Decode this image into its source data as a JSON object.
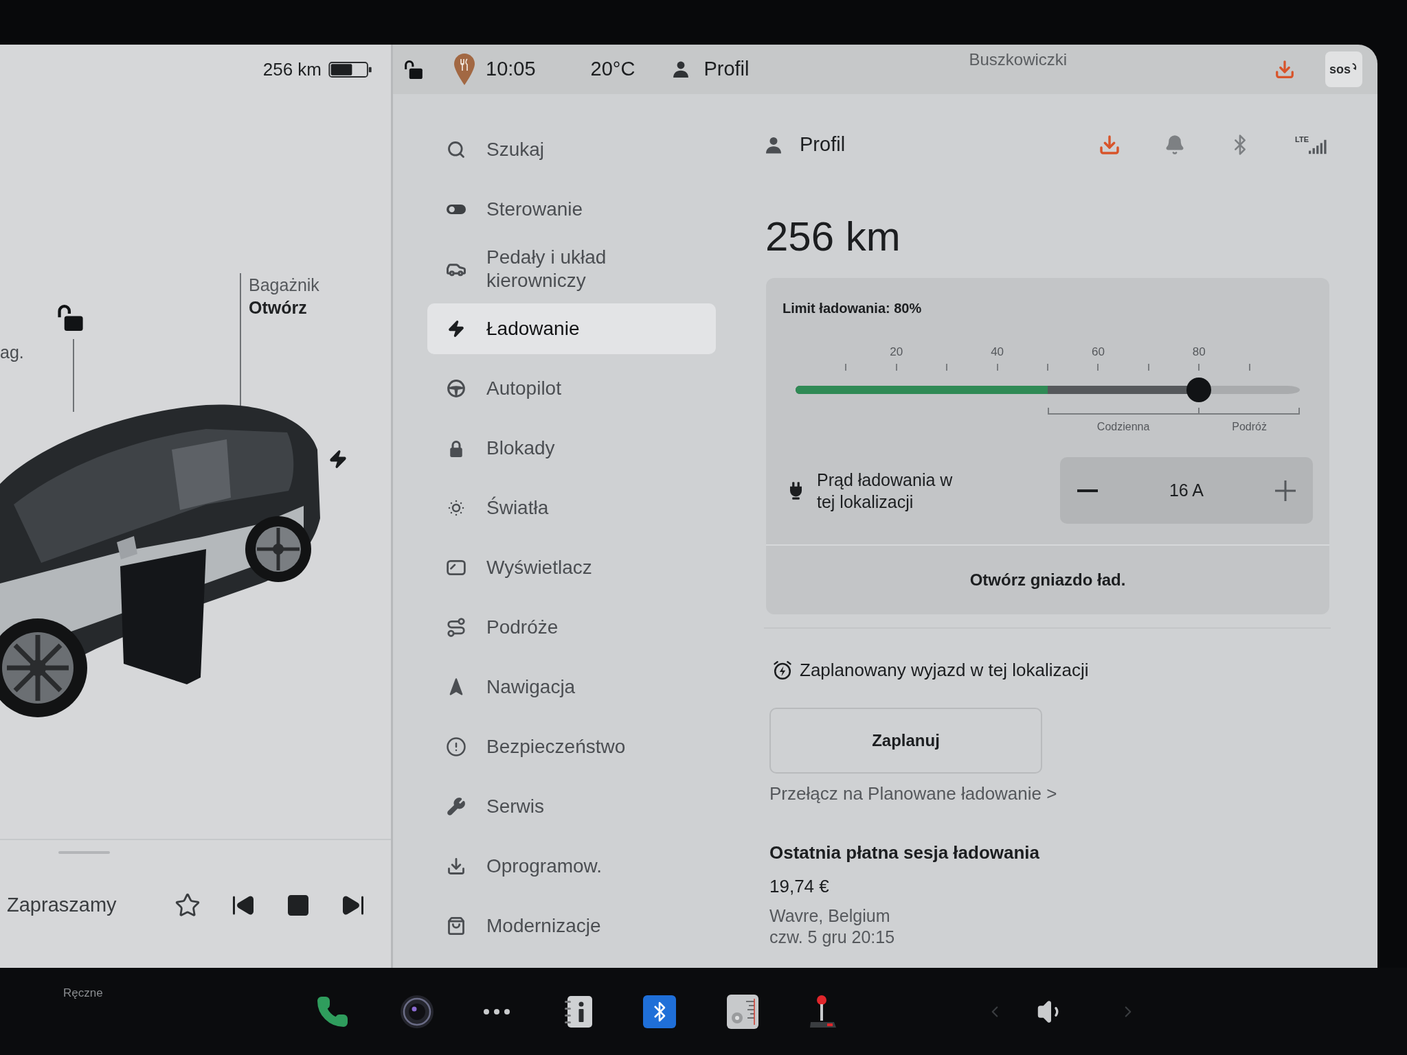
{
  "status_bar": {
    "range": "256 km",
    "time": "10:05",
    "temperature": "20°C",
    "profile": "Profil",
    "map_label": "Buszkowiczki",
    "sos": "sos"
  },
  "car_view": {
    "door_label": "ag.",
    "trunk": {
      "title": "Bagażnik",
      "action": "Otwórz"
    }
  },
  "media": {
    "title": "Zapraszamy",
    "favorite": false
  },
  "menu": {
    "items": [
      {
        "label": "Szukaj",
        "selected": false
      },
      {
        "label": "Sterowanie",
        "selected": false
      },
      {
        "label": "Pedały i układ kierowniczy",
        "selected": false
      },
      {
        "label": "Ładowanie",
        "selected": true
      },
      {
        "label": "Autopilot",
        "selected": false
      },
      {
        "label": "Blokady",
        "selected": false
      },
      {
        "label": "Światła",
        "selected": false
      },
      {
        "label": "Wyświetlacz",
        "selected": false
      },
      {
        "label": "Podróże",
        "selected": false
      },
      {
        "label": "Nawigacja",
        "selected": false
      },
      {
        "label": "Bezpieczeństwo",
        "selected": false
      },
      {
        "label": "Serwis",
        "selected": false
      },
      {
        "label": "Oprogramow.",
        "selected": false
      },
      {
        "label": "Modernizacje",
        "selected": false
      }
    ]
  },
  "profile_header": {
    "name": "Profil",
    "network": "LTE"
  },
  "range": "256 km",
  "charge_limit": {
    "label": "Limit ładowania: 80%",
    "level": 0.8,
    "scale_labels": [
      "20",
      "40",
      "60",
      "80"
    ],
    "zones": [
      "Codzienna",
      "Podróż"
    ]
  },
  "current_charge": {
    "level": 0.5
  },
  "charging_current": {
    "label": "Prąd ładowania w tej lokalizacji",
    "value": "16 A"
  },
  "charge_port_button": "Otwórz gniazdo ład.",
  "scheduled_departure": {
    "title": "Zaplanowany wyjazd w tej lokalizacji",
    "button": "Zaplanuj",
    "link": "Przełącz na Planowane ładowanie >"
  },
  "last_session": {
    "title": "Ostatnia płatna sesja ładowania",
    "amount": "19,74 €",
    "location": "Wavre, Belgium",
    "date": "czw. 5 gru 20:15"
  },
  "taskbar": {
    "climate_mode": "Ręczne"
  }
}
